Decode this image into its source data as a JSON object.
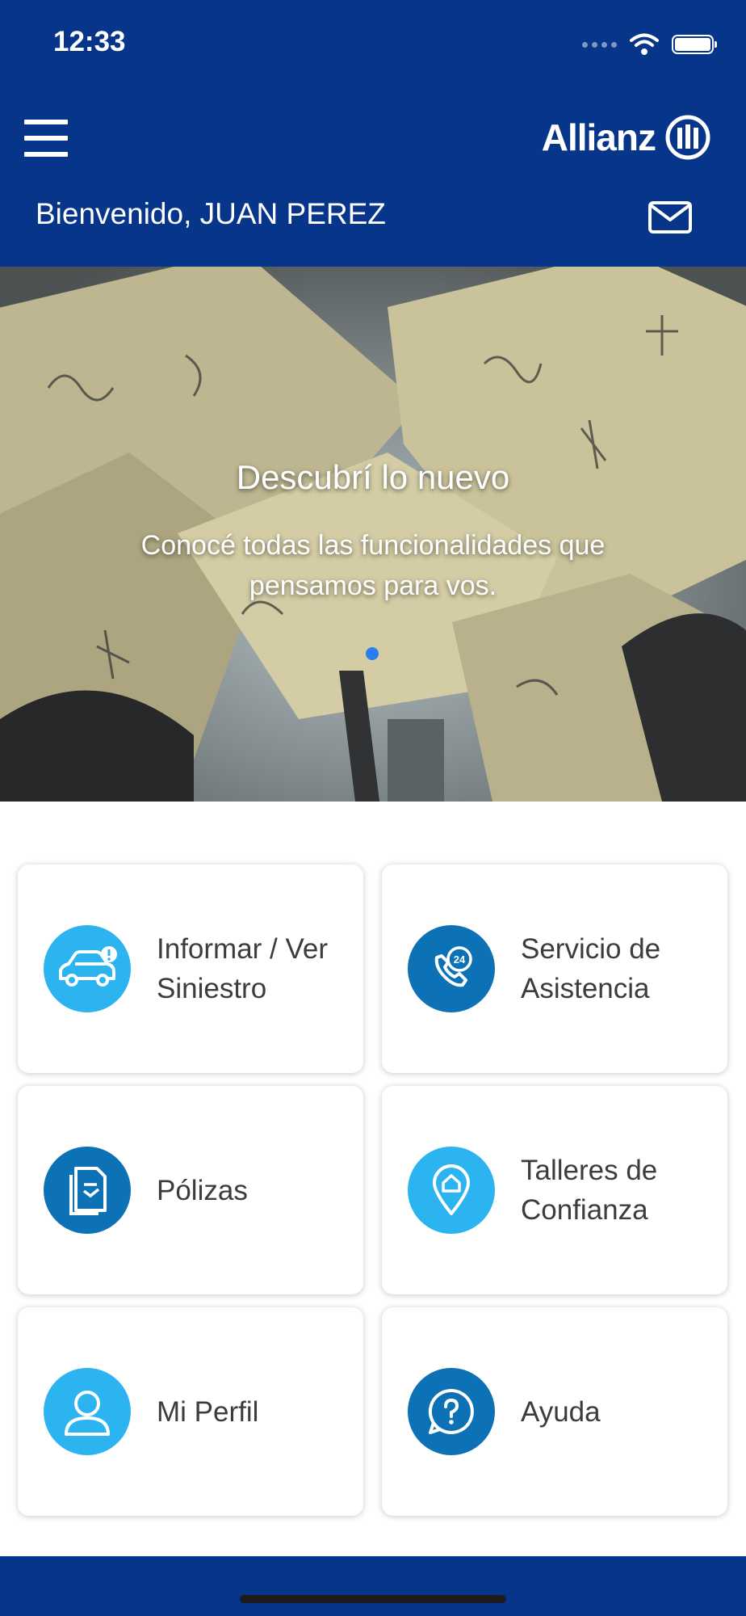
{
  "status_bar": {
    "time": "12:33"
  },
  "header": {
    "logo_text": "Allianz",
    "welcome": "Bienvenido, JUAN PEREZ"
  },
  "banner": {
    "title": "Descubrí lo nuevo",
    "text": "Conocé todas las funcionalidades que pensamos para vos."
  },
  "tiles": [
    {
      "label": "Informar / Ver Siniestro",
      "icon": "car-warning-icon",
      "color": "#2cb4f0"
    },
    {
      "label": "Servicio de Asistencia",
      "icon": "phone-24-icon",
      "color": "#0c72b5"
    },
    {
      "label": "Pólizas",
      "icon": "policy-document-icon",
      "color": "#0c72b5"
    },
    {
      "label": "Talleres de Confianza",
      "icon": "location-pin-icon",
      "color": "#2cb4f0"
    },
    {
      "label": "Mi Perfil",
      "icon": "user-icon",
      "color": "#2cb4f0"
    },
    {
      "label": "Ayuda",
      "icon": "help-question-icon",
      "color": "#0c72b5"
    }
  ],
  "colors": {
    "header": "#06358a",
    "accent_light": "#2cb4f0",
    "accent_dark": "#0c72b5"
  }
}
